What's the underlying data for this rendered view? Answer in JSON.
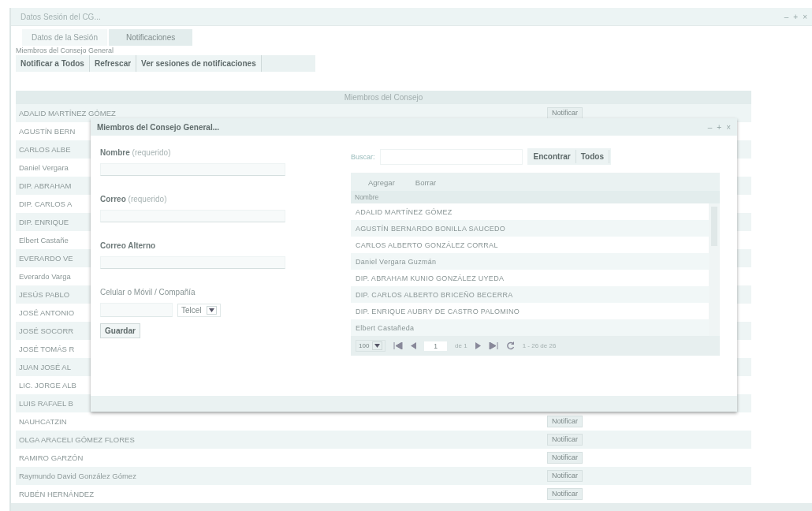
{
  "window": {
    "title": "Datos Sesión del CG...",
    "controls": [
      "–",
      "+",
      "×"
    ]
  },
  "tabs": [
    {
      "label": "Datos de la Sesión",
      "selected": false
    },
    {
      "label": "Notificaciones",
      "selected": true
    }
  ],
  "section_label": "Miembros del Consejo General",
  "toolbar": [
    "Notificar a Todos",
    "Refrescar",
    "Ver sesiones de notificaciones"
  ],
  "table": {
    "header": "Miembros del Consejo",
    "rows": [
      {
        "name": "ADALID MARTÍNEZ GÓMEZ",
        "button": "Notificar"
      },
      {
        "name": "AGUSTÍN BERN"
      },
      {
        "name": "CARLOS ALBE"
      },
      {
        "name": "Daniel Vergara"
      },
      {
        "name": "DIP. ABRAHAM"
      },
      {
        "name": "DIP. CARLOS A"
      },
      {
        "name": "DIP. ENRIQUE"
      },
      {
        "name": "Elbert Castañe"
      },
      {
        "name": "EVERARDO VE"
      },
      {
        "name": "Everardo Varga"
      },
      {
        "name": "JESÚS PABLO"
      },
      {
        "name": "JOSÉ ANTONIO"
      },
      {
        "name": "JOSÉ SOCORR"
      },
      {
        "name": "JOSÉ TOMÁS R"
      },
      {
        "name": "JUAN JOSÉ AL"
      },
      {
        "name": "LIC. JORGE ALB"
      },
      {
        "name": "LUIS RAFAEL B"
      },
      {
        "name": "NAUHCATZIN",
        "button": "Notificar"
      },
      {
        "name": "OLGA ARACELI GÓMEZ FLORES",
        "button": "Notificar"
      },
      {
        "name": "RAMIRO GARZÓN",
        "button": "Notificar"
      },
      {
        "name": "Raymundo David González Gómez",
        "button": "Notificar"
      },
      {
        "name": "RUBÉN HERNÁNDEZ",
        "button": "Notificar"
      }
    ]
  },
  "dialog": {
    "title": "Miembros del Consejo General...",
    "controls": [
      "–",
      "+",
      "×"
    ],
    "form": {
      "fields": [
        {
          "label": "Nombre",
          "hint": "(requerido)"
        },
        {
          "label": "Correo",
          "hint": "(requerido)"
        },
        {
          "label": "Correo Alterno"
        }
      ],
      "phone_label": "Celular o Móvil / Compañía",
      "company": "Telcel",
      "save": "Guardar"
    },
    "search": {
      "label": "Buscar:",
      "buttons": [
        "Encontrar",
        "Todos"
      ]
    },
    "grid": {
      "toolbar": [
        "Agregar",
        "Borrar"
      ],
      "column": "Nombre",
      "rows": [
        "ADALID MARTÍNEZ GÓMEZ",
        "AGUSTÍN BERNARDO BONILLA SAUCEDO",
        "CARLOS ALBERTO GONZÁLEZ CORRAL",
        "Daniel Vergara Guzmán",
        "DIP. ABRAHAM KUNIO GONZÁLEZ UYEDA",
        "DIP. CARLOS ALBERTO BRICEÑO BECERRA",
        "DIP. ENRIQUE AUBRY DE CASTRO PALOMINO",
        "Elbert Castañeda"
      ],
      "pager": {
        "page_size": "100",
        "page": "1",
        "of": "de 1",
        "summary": "1 - 26 de 26"
      }
    }
  }
}
